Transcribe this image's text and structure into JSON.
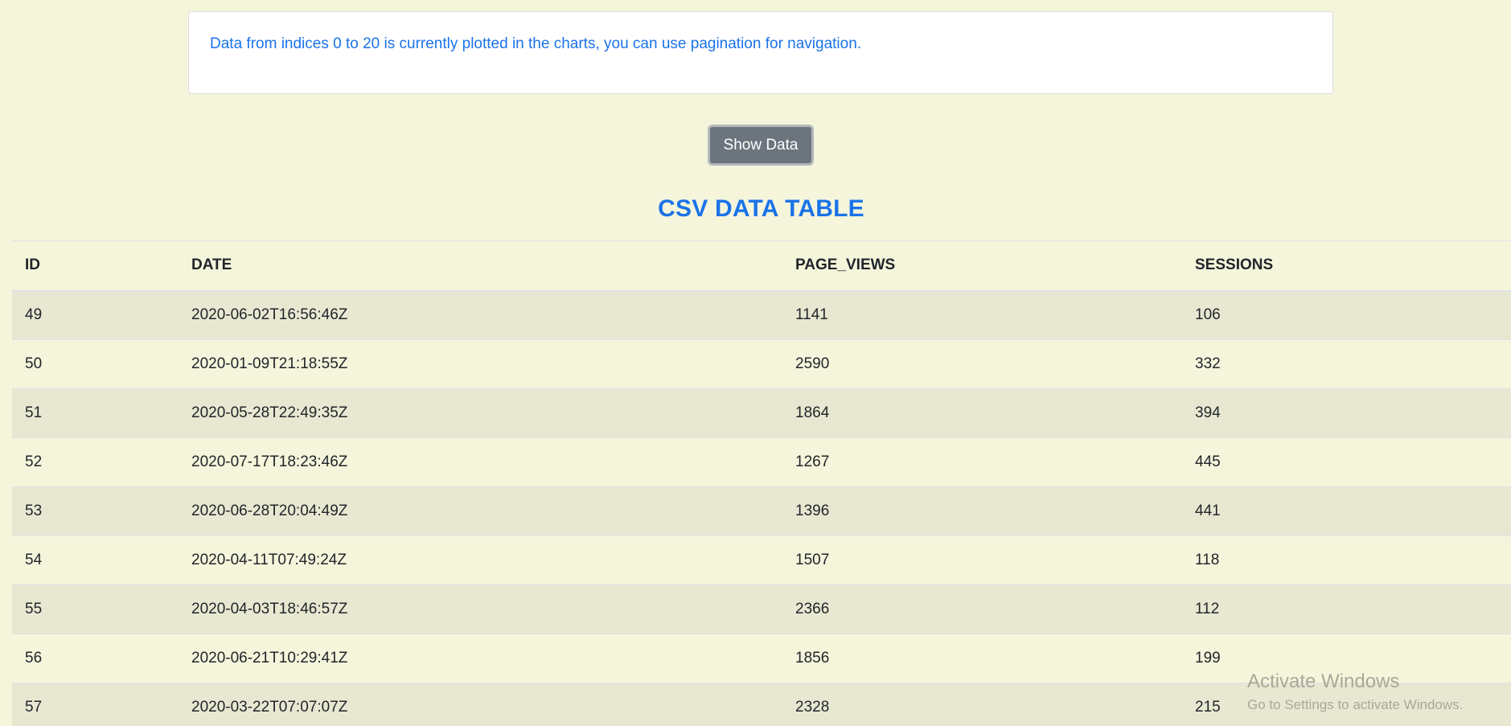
{
  "info": {
    "message": "Data from indices 0 to 20 is currently plotted in the charts, you can use pagination for navigation."
  },
  "controls": {
    "show_data_label": "Show Data"
  },
  "table": {
    "title": "CSV DATA TABLE",
    "columns": [
      "ID",
      "DATE",
      "PAGE_VIEWS",
      "SESSIONS"
    ],
    "rows": [
      [
        "49",
        "2020-06-02T16:56:46Z",
        "1141",
        "106"
      ],
      [
        "50",
        "2020-01-09T21:18:55Z",
        "2590",
        "332"
      ],
      [
        "51",
        "2020-05-28T22:49:35Z",
        "1864",
        "394"
      ],
      [
        "52",
        "2020-07-17T18:23:46Z",
        "1267",
        "445"
      ],
      [
        "53",
        "2020-06-28T20:04:49Z",
        "1396",
        "441"
      ],
      [
        "54",
        "2020-04-11T07:49:24Z",
        "1507",
        "118"
      ],
      [
        "55",
        "2020-04-03T18:46:57Z",
        "2366",
        "112"
      ],
      [
        "56",
        "2020-06-21T10:29:41Z",
        "1856",
        "199"
      ],
      [
        "57",
        "2020-03-22T07:07:07Z",
        "2328",
        "215"
      ]
    ]
  },
  "watermark": {
    "title": "Activate Windows",
    "subtitle": "Go to Settings to activate Windows."
  }
}
